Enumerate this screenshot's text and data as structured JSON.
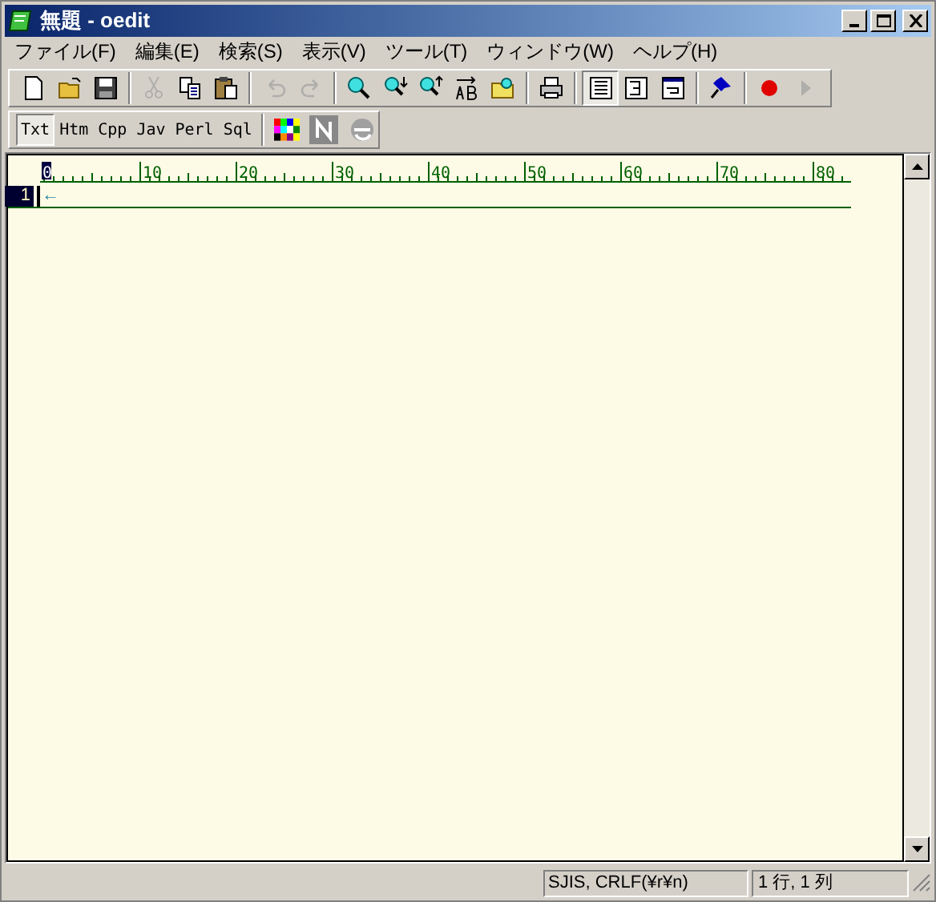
{
  "window": {
    "title": "無題 - oedit"
  },
  "menu": [
    "ファイル(F)",
    "編集(E)",
    "検索(S)",
    "表示(V)",
    "ツール(T)",
    "ウィンドウ(W)",
    "ヘルプ(H)"
  ],
  "toolbar": [
    {
      "kind": "new",
      "disabled": false
    },
    {
      "kind": "open",
      "disabled": false
    },
    {
      "kind": "save",
      "disabled": false
    },
    {
      "kind": "sep"
    },
    {
      "kind": "cut",
      "disabled": true
    },
    {
      "kind": "copy",
      "disabled": false
    },
    {
      "kind": "paste",
      "disabled": false
    },
    {
      "kind": "sep"
    },
    {
      "kind": "undo",
      "disabled": true
    },
    {
      "kind": "redo",
      "disabled": true
    },
    {
      "kind": "sep"
    },
    {
      "kind": "find",
      "disabled": false
    },
    {
      "kind": "find-next",
      "disabled": false
    },
    {
      "kind": "find-prev",
      "disabled": false
    },
    {
      "kind": "replace",
      "disabled": false
    },
    {
      "kind": "grep",
      "disabled": false
    },
    {
      "kind": "sep"
    },
    {
      "kind": "print",
      "disabled": false
    },
    {
      "kind": "sep"
    },
    {
      "kind": "wrap-none",
      "selected": true
    },
    {
      "kind": "wrap-window",
      "selected": false
    },
    {
      "kind": "wrap-column",
      "selected": false
    },
    {
      "kind": "sep"
    },
    {
      "kind": "pin",
      "disabled": false
    },
    {
      "kind": "sep"
    },
    {
      "kind": "record",
      "disabled": false
    },
    {
      "kind": "play",
      "disabled": true
    }
  ],
  "languages": [
    {
      "label": "Txt",
      "selected": true
    },
    {
      "label": "Htm",
      "selected": false
    },
    {
      "label": "Cpp",
      "selected": false
    },
    {
      "label": "Jav",
      "selected": false
    },
    {
      "label": "Perl",
      "selected": false
    },
    {
      "label": "Sql",
      "selected": false
    }
  ],
  "ruler": {
    "labels": [
      "0",
      "10",
      "20",
      "30",
      "40",
      "50",
      "60",
      "70",
      "80"
    ]
  },
  "editor": {
    "line_number": "1",
    "eol_mark": "←"
  },
  "status_bar": {
    "encoding": "SJIS, CRLF(¥r¥n)",
    "position": "1 行, 1 列"
  }
}
